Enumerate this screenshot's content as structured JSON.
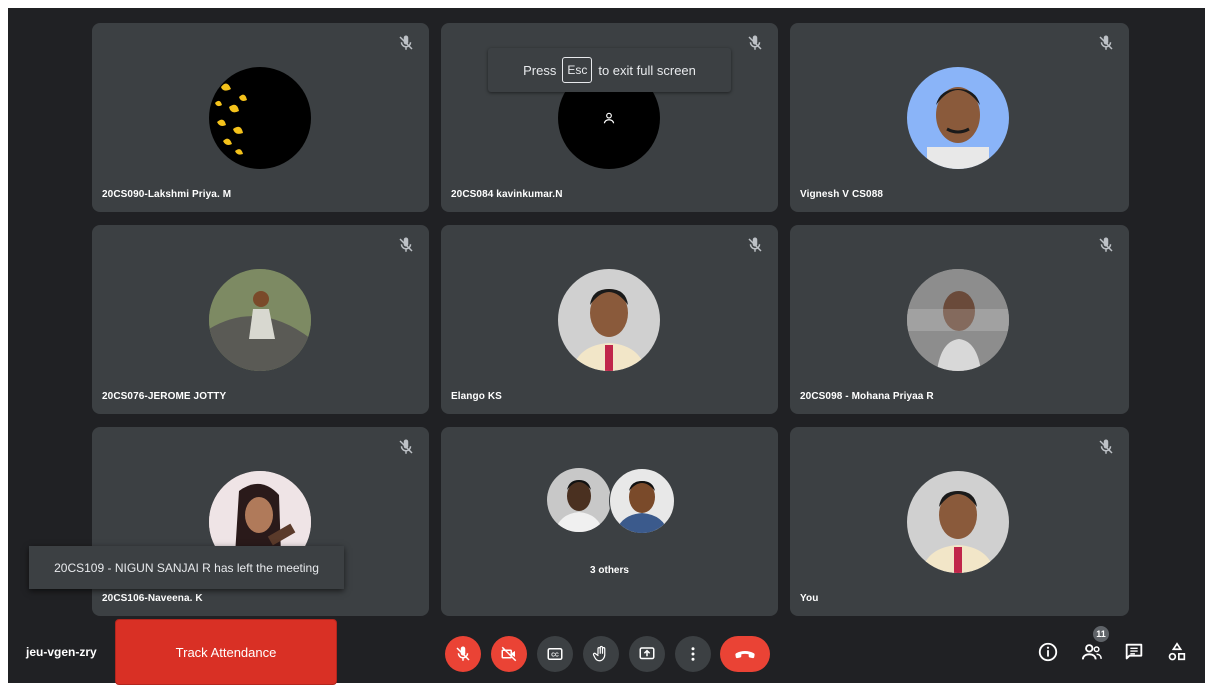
{
  "fullscreen_hint": {
    "press": "Press",
    "key": "Esc",
    "rest": "to exit full screen"
  },
  "tiles": [
    {
      "name": "20CS090-Lakshmi Priya. M"
    },
    {
      "name": "20CS084 kavinkumar.N"
    },
    {
      "name": "Vignesh V CS088"
    },
    {
      "name": "20CS076-JEROME JOTTY"
    },
    {
      "name": "Elango KS"
    },
    {
      "name": "20CS098 - Mohana Priyaa R"
    },
    {
      "name": "20CS106-Naveena. K"
    },
    {
      "name": "3 others"
    },
    {
      "name": "You"
    }
  ],
  "toast": "20CS109 - NIGUN SANJAI R has left the meeting",
  "meeting_code": "jeu-vgen-zry",
  "track_attendance": "Track Attendance",
  "participants_count": "11",
  "colors": {
    "accent_red": "#ea4335",
    "tile_bg": "#3c4043",
    "stage_bg": "#202124"
  }
}
